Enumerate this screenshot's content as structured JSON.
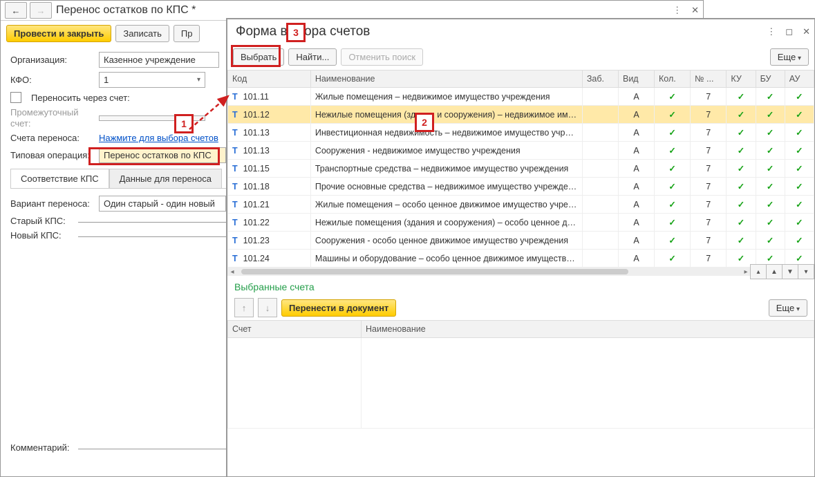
{
  "bg": {
    "title": "Перенос остатков по КПС *",
    "btn_post_close": "Провести и закрыть",
    "btn_write": "Записать",
    "btn_pr": "Пр",
    "lbl_org": "Организация:",
    "org_value": "Казенное учреждение",
    "lbl_kfo": "КФО:",
    "kfo_value": "1",
    "chk_label": "Переносить через счет:",
    "lbl_interim": "Промежуточный счет:",
    "lbl_accounts": "Счета переноса:",
    "link_accounts": "Нажмите для выбора счетов",
    "lbl_typop": "Типовая операция:",
    "typop_value": "Перенос остатков по КПС",
    "tab1": "Соответствие КПС",
    "tab2": "Данные для переноса",
    "lbl_variant": "Вариант переноса:",
    "variant_value": "Один старый - один новый",
    "lbl_old": "Старый КПС:",
    "lbl_new": "Новый КПС:",
    "lbl_comment": "Комментарий:"
  },
  "fg": {
    "title": "Форма выбора счетов",
    "btn_select": "Выбрать",
    "btn_find": "Найти...",
    "btn_cancel_search": "Отменить поиск",
    "btn_more": "Еще",
    "cols": {
      "code": "Код",
      "name": "Наименование",
      "zab": "Заб.",
      "vid": "Вид",
      "kol": "Кол.",
      "no": "№ ...",
      "ku": "КУ",
      "bu": "БУ",
      "au": "АУ"
    },
    "rows": [
      {
        "code": "101.11",
        "name": "Жилые помещения – недвижимое имущество учреждения",
        "vid": "А",
        "kol": "✓",
        "no": "7",
        "ku": "✓",
        "bu": "✓",
        "au": "✓"
      },
      {
        "code": "101.12",
        "name": "Нежилые помещения (здания и сооружения) – недвижимое им…",
        "vid": "А",
        "kol": "✓",
        "no": "7",
        "ku": "✓",
        "bu": "✓",
        "au": "✓",
        "sel": true
      },
      {
        "code": "101.13",
        "name": "Инвестиционная недвижимость – недвижимое имущество учре…",
        "vid": "А",
        "kol": "✓",
        "no": "7",
        "ku": "✓",
        "bu": "✓",
        "au": "✓"
      },
      {
        "code": "101.13",
        "name": "Сооружения - недвижимое имущество учреждения",
        "vid": "А",
        "kol": "✓",
        "no": "7",
        "ku": "✓",
        "bu": "✓",
        "au": "✓"
      },
      {
        "code": "101.15",
        "name": "Транспортные средства – недвижимое имущество учреждения",
        "vid": "А",
        "kol": "✓",
        "no": "7",
        "ku": "✓",
        "bu": "✓",
        "au": "✓"
      },
      {
        "code": "101.18",
        "name": "Прочие основные средства – недвижимое имущество учрежде…",
        "vid": "А",
        "kol": "✓",
        "no": "7",
        "ku": "✓",
        "bu": "✓",
        "au": "✓"
      },
      {
        "code": "101.21",
        "name": "Жилые помещения – особо ценное движимое имущество учре…",
        "vid": "А",
        "kol": "✓",
        "no": "7",
        "ku": "✓",
        "bu": "✓",
        "au": "✓"
      },
      {
        "code": "101.22",
        "name": "Нежилые помещения (здания и сооружения) – особо ценное д…",
        "vid": "А",
        "kol": "✓",
        "no": "7",
        "ku": "✓",
        "bu": "✓",
        "au": "✓"
      },
      {
        "code": "101.23",
        "name": "Сооружения - особо ценное движимое имущество учреждения",
        "vid": "А",
        "kol": "✓",
        "no": "7",
        "ku": "✓",
        "bu": "✓",
        "au": "✓"
      },
      {
        "code": "101.24",
        "name": "Машины и оборудование – особо ценное движимое имуществ…",
        "vid": "А",
        "kol": "✓",
        "no": "7",
        "ku": "✓",
        "bu": "✓",
        "au": "✓"
      }
    ],
    "selected_title": "Выбранные счета",
    "btn_transfer": "Перенести в документ",
    "col_account": "Счет",
    "col_name2": "Наименование"
  },
  "annot": {
    "n1": "1",
    "n2": "2",
    "n3": "3"
  }
}
